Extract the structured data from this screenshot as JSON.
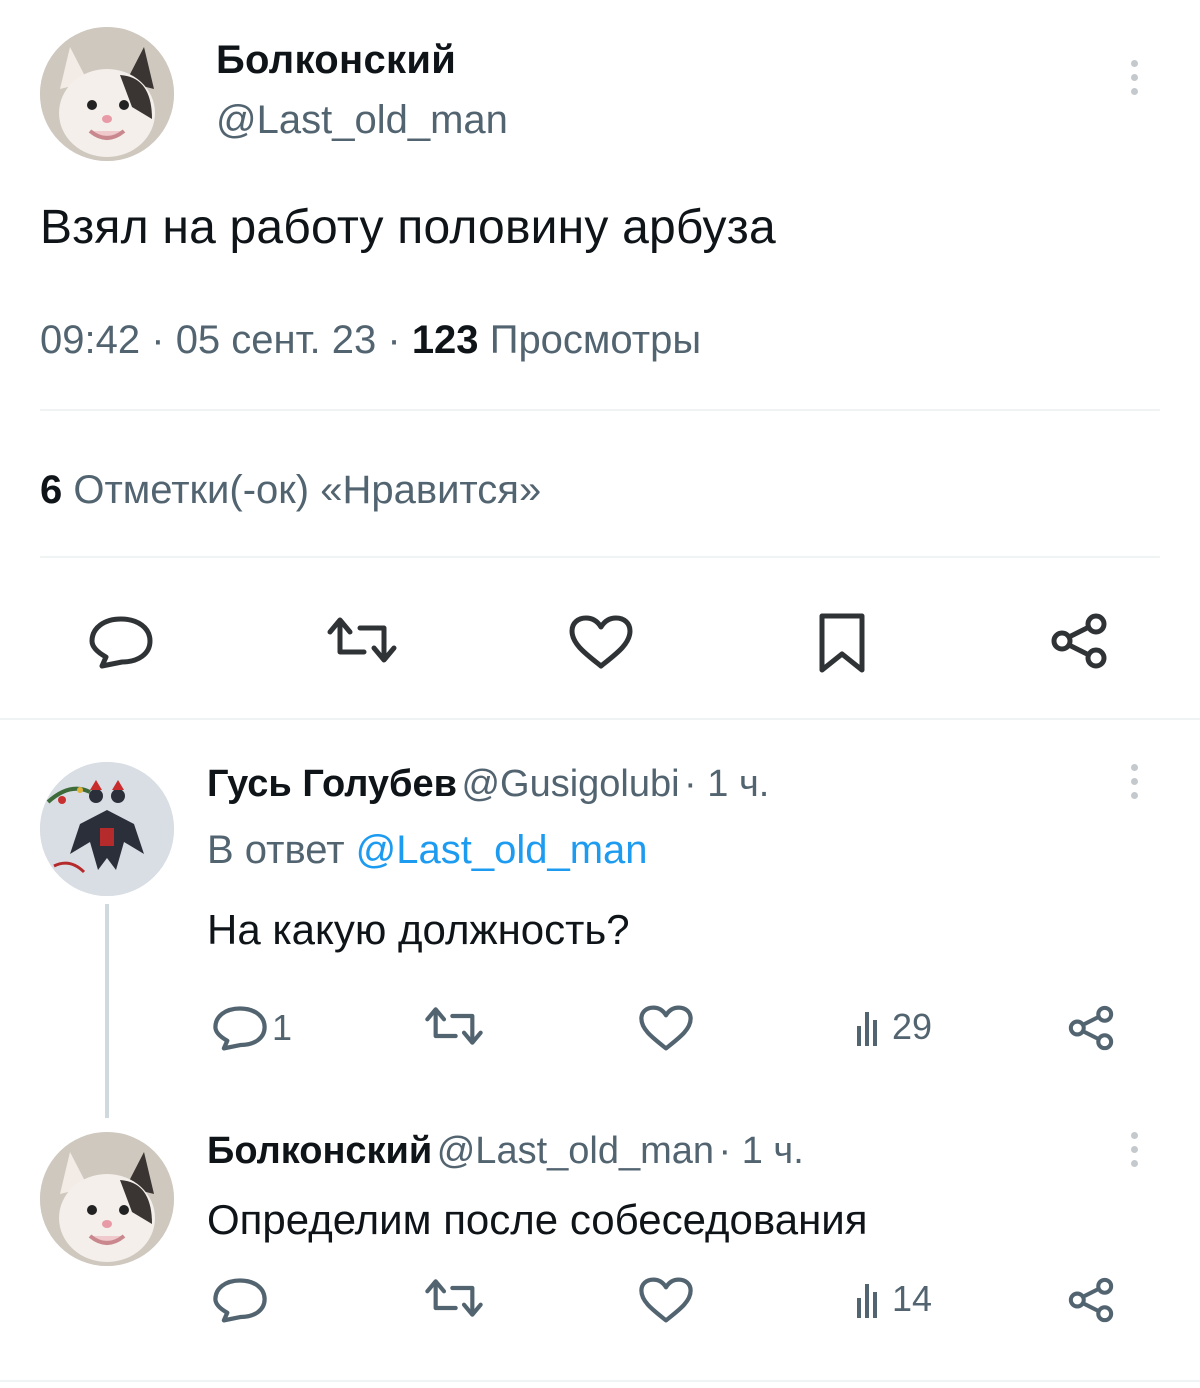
{
  "main_tweet": {
    "author_name": "Болконский",
    "author_handle": "@Last_old_man",
    "text": "Взял на работу половину арбуза",
    "time": "09:42",
    "date": "05 сент. 23",
    "views_count": "123",
    "views_label": "Просмотры",
    "separator": "·",
    "likes_count": "6",
    "likes_label": "Отметки(-ок) «Нравится»",
    "action_icons": [
      "reply-icon",
      "retweet-icon",
      "like-icon",
      "bookmark-icon",
      "share-icon"
    ]
  },
  "replies": [
    {
      "author_name": "Гусь Голубев",
      "author_handle": "@Gusigolubi",
      "time_ago": "· 1 ч.",
      "reply_prefix": "В ответ",
      "reply_to": "@Last_old_man",
      "text": "На какую должность?",
      "reply_count": "1",
      "views_count": "29"
    },
    {
      "author_name": "Болконский",
      "author_handle": "@Last_old_man",
      "time_ago": "· 1 ч.",
      "text": "Определим после собеседования",
      "reply_count": "",
      "views_count": "14"
    }
  ],
  "colors": {
    "text": "#0f1419",
    "secondary": "#536471",
    "link": "#1d9bf0",
    "divider": "#eff3f4"
  }
}
